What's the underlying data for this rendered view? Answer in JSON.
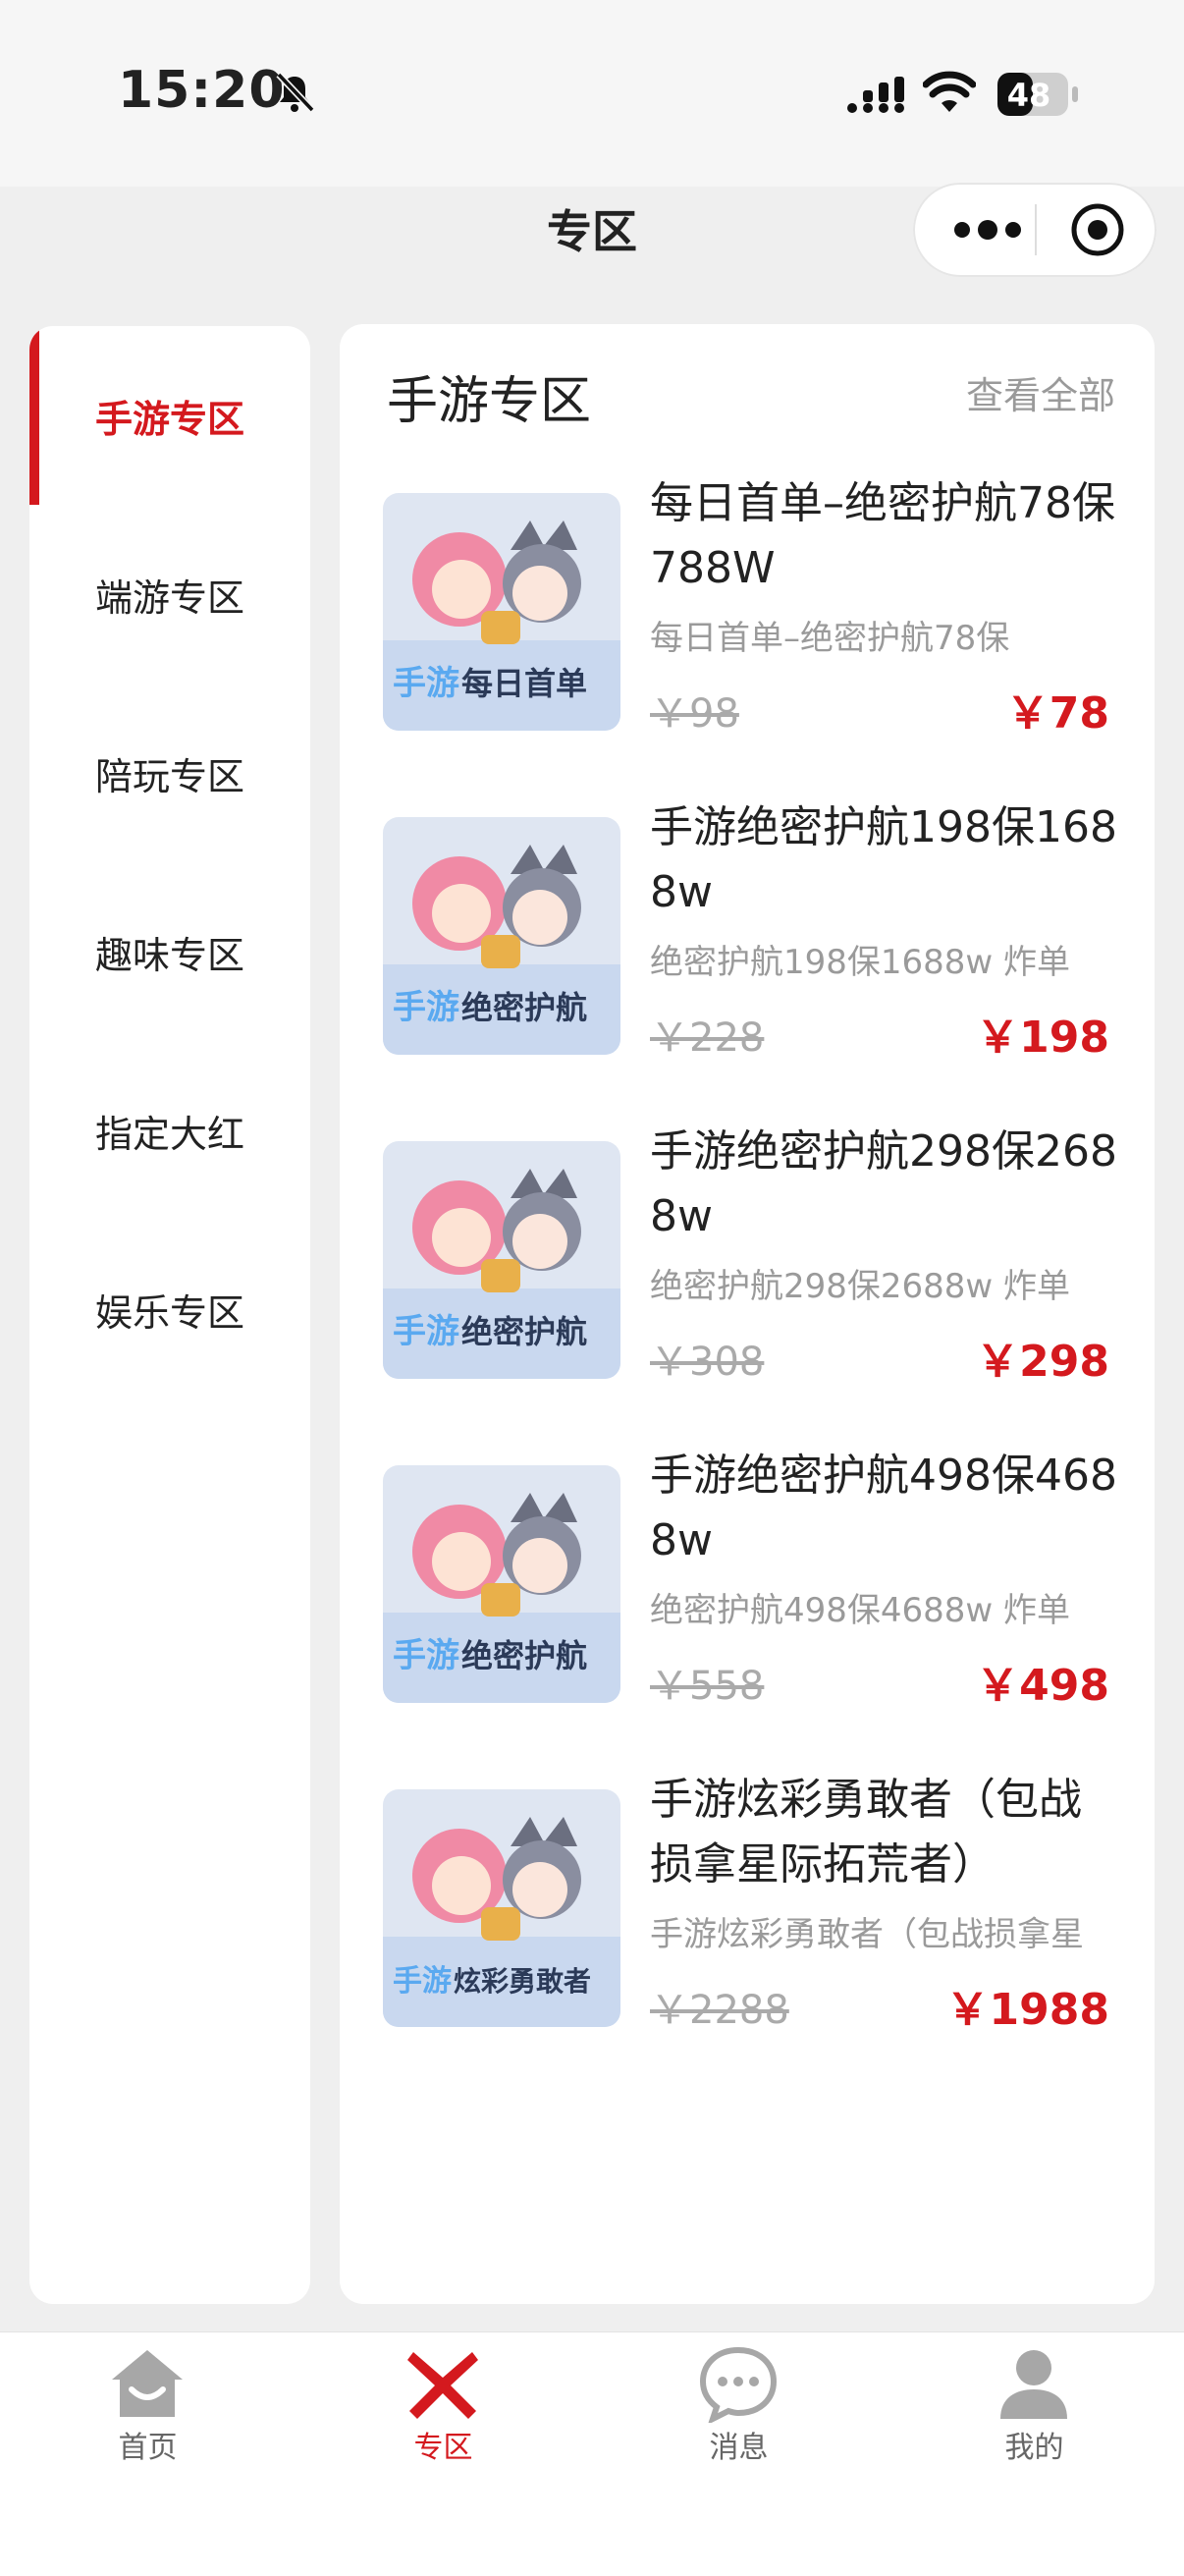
{
  "status": {
    "time": "15:20",
    "battery": "48"
  },
  "nav": {
    "title": "专区"
  },
  "sidebar": {
    "items": [
      {
        "label": "手游专区"
      },
      {
        "label": "端游专区"
      },
      {
        "label": "陪玩专区"
      },
      {
        "label": "趣味专区"
      },
      {
        "label": "指定大红"
      },
      {
        "label": "娱乐专区"
      }
    ]
  },
  "panel": {
    "title": "手游专区",
    "view_all": "查看全部",
    "items": [
      {
        "title": "每日首单–绝密护航78保788W",
        "subtitle": "每日首单–绝密护航78保",
        "original_price": "￥98",
        "price": "￥78",
        "image_caption": "每日首单"
      },
      {
        "title": "手游绝密护航198保1688w",
        "subtitle": "绝密护航198保1688w 炸单",
        "original_price": "￥228",
        "price": "￥198",
        "image_caption": "绝密护航"
      },
      {
        "title": "手游绝密护航298保2688w",
        "subtitle": "绝密护航298保2688w 炸单",
        "original_price": "￥308",
        "price": "￥298",
        "image_caption": "绝密护航"
      },
      {
        "title": "手游绝密护航498保4688w",
        "subtitle": "绝密护航498保4688w 炸单",
        "original_price": "￥558",
        "price": "￥498",
        "image_caption": "绝密护航"
      },
      {
        "title": "手游炫彩勇敢者（包战损拿星际拓荒者）",
        "subtitle": "手游炫彩勇敢者（包战损拿星",
        "original_price": "￥2288",
        "price": "￥1988",
        "image_caption": "炫彩勇敢者"
      }
    ],
    "image_prefix": "手游"
  },
  "tabbar": {
    "items": [
      {
        "label": "首页",
        "icon": "home-icon"
      },
      {
        "label": "专区",
        "icon": "zone-icon"
      },
      {
        "label": "消息",
        "icon": "message-icon"
      },
      {
        "label": "我的",
        "icon": "profile-icon"
      }
    ]
  },
  "colors": {
    "accent": "#d4191e"
  }
}
